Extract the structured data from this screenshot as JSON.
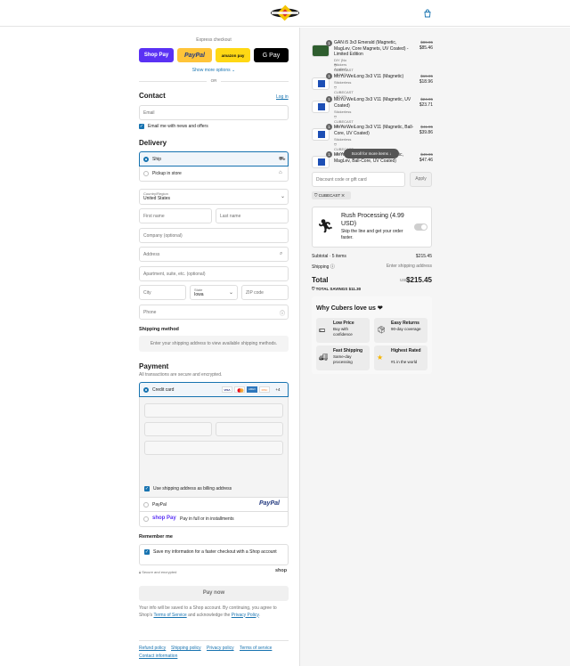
{
  "header": {
    "logo": "SpeedCubeShop",
    "cart_icon": "shopping-bag-icon"
  },
  "express": {
    "title": "Express checkout",
    "shop_pay": "Shop Pay",
    "paypal": "PayPal",
    "amazon_pay": "amazon pay",
    "google_pay": "G Pay",
    "show_more": "Show more options",
    "or": "OR"
  },
  "contact": {
    "title": "Contact",
    "login": "Log in",
    "email_placeholder": "Email",
    "news_label": "Email me with news and offers"
  },
  "delivery": {
    "title": "Delivery",
    "ship": "Ship",
    "pickup": "Pickup in store",
    "country_label": "Country/Region",
    "country_value": "United States",
    "first_name": "First name",
    "last_name": "Last name",
    "company": "Company (optional)",
    "address": "Address",
    "apartment": "Apartment, suite, etc. (optional)",
    "city": "City",
    "state_label": "State",
    "state_value": "Iowa",
    "zip": "ZIP code",
    "phone": "Phone"
  },
  "shipping_method": {
    "title": "Shipping method",
    "message": "Enter your shipping address to view available shipping methods."
  },
  "payment": {
    "title": "Payment",
    "subtitle": "All transactions are secure and encrypted.",
    "credit_card": "Credit card",
    "card_brands": [
      "VISA",
      "MC",
      "AMEX",
      "DISC"
    ],
    "more_brands": "+4",
    "billing_same": "Use shipping address as billing address",
    "paypal_label": "PayPal",
    "paypal_logo": "PayPal",
    "shop_pay_logo": "shop Pay",
    "shop_pay_text": "Pay in full or in installments"
  },
  "remember": {
    "title": "Remember me",
    "save_label": "Save my information for a faster checkout with a Shop account",
    "secure": "Secure and encrypted",
    "shop_logo": "shop"
  },
  "pay_now": "Pay now",
  "disclaimer": {
    "before_terms": "Your info will be saved to a Shop account. By continuing, you agree to Shop's",
    "terms": "Terms of Service",
    "middle": "and acknowledge the",
    "privacy": "Privacy Policy",
    "end": "."
  },
  "footer_links": [
    "Refund policy",
    "Shipping policy",
    "Privacy policy",
    "Terms of service",
    "Contact information"
  ],
  "cart": {
    "items": [
      {
        "qty": "1",
        "name": "GAN i5 3x3 Emerald (Magnetic, MagLev, Core Magnets, UV Coated) - Limited Edition",
        "variant": "DIY (No Stickers Applied)",
        "discount": "CUBECAST (-$4.49)",
        "orig": "$89.95",
        "price": "$85.46"
      },
      {
        "qty": "1",
        "name": "MoYu WeiLong 3x3 V11 (Magnetic)",
        "variant": "Stickerless",
        "discount": "CUBECAST (-$0.99)",
        "orig": "$19.95",
        "price": "$18.96"
      },
      {
        "qty": "1",
        "name": "MoYu WeiLong 3x3 V11 (Magnetic, UV Coated)",
        "variant": "Stickerless",
        "discount": "CUBECAST (-$1.24)",
        "orig": "$24.95",
        "price": "$23.71"
      },
      {
        "qty": "1",
        "name": "MoYu WeiLong 3x3 V11 (Magnetic, Ball-Core, UV Coated)",
        "variant": "Stickerless",
        "discount": "CUBECAST (-$2.09)",
        "orig": "$41.95",
        "price": "$39.86"
      },
      {
        "qty": "1",
        "name": "MoYu WeiLong 3x3 V11 (Magnetic, MagLev, Ball-Core, UV Coated)",
        "variant": "",
        "discount": "",
        "orig": "$49.95",
        "price": "$47.46"
      }
    ],
    "scroll_hint": "Scroll for more items",
    "discount_placeholder": "Discount code or gift card",
    "apply": "Apply",
    "code_tag": "CUBECAST",
    "rush_title": "Rush Processing (4.99 USD)",
    "rush_desc": "Skip the line and get your order faster.",
    "subtotal_label": "Subtotal · 5 items",
    "subtotal_value": "$215.45",
    "shipping_label": "Shipping",
    "shipping_value": "Enter shipping address",
    "total_label": "Total",
    "currency": "USD",
    "total_value": "$215.45",
    "savings_label": "TOTAL SAVINGS",
    "savings_value": "$11.30"
  },
  "why": {
    "title": "Why Cubers love us ❤",
    "features": [
      {
        "title": "Low Price",
        "desc": "Buy with confidence",
        "icon": "money-icon"
      },
      {
        "title": "Easy Returns",
        "desc": "90-day coverage",
        "icon": "box-icon"
      },
      {
        "title": "Fast Shipping",
        "desc": "Same-day processing",
        "icon": "truck-icon"
      },
      {
        "title": "Highest Rated",
        "desc": "#1 in the world",
        "icon": "star-icon"
      }
    ]
  },
  "colors": {
    "accent": "#1773b0",
    "shop_pay": "#5a31f4",
    "paypal": "#ffc439",
    "amazon": "#ffd814"
  }
}
